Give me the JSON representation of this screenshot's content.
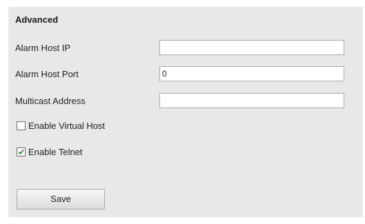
{
  "section": {
    "title": "Advanced"
  },
  "fields": {
    "alarm_host_ip": {
      "label": "Alarm Host IP",
      "value": ""
    },
    "alarm_host_port": {
      "label": "Alarm Host Port",
      "value": "0"
    },
    "multicast_address": {
      "label": "Multicast Address",
      "value": ""
    }
  },
  "options": {
    "enable_virtual_host": {
      "label": "Enable Virtual Host",
      "checked": false
    },
    "enable_telnet": {
      "label": "Enable Telnet",
      "checked": true
    }
  },
  "actions": {
    "save_label": "Save"
  },
  "colors": {
    "panel_background": "#e8e8e8",
    "check_mark": "#2e8b2e"
  }
}
